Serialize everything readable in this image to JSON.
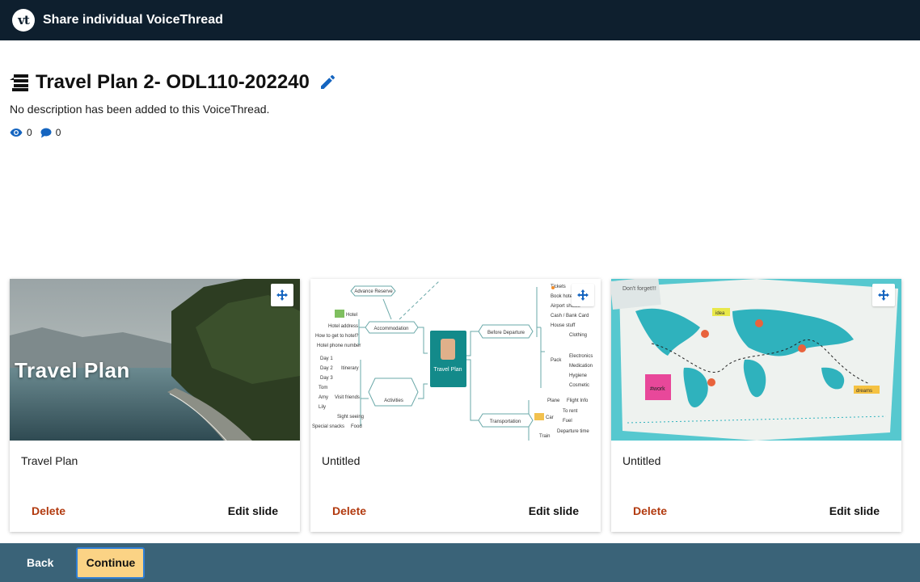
{
  "app": {
    "window_title": "Share individual VoiceThread",
    "logo_text": "vt"
  },
  "voicethread": {
    "title": "Travel Plan 2- ODL110-202240",
    "description": "No description has been added to this VoiceThread.",
    "views": "0",
    "comments": "0"
  },
  "slides": [
    {
      "title": "Travel Plan",
      "thumbnail_text": "Travel Plan",
      "delete_label": "Delete",
      "edit_label": "Edit slide"
    },
    {
      "title": "Untitled",
      "delete_label": "Delete",
      "edit_label": "Edit slide",
      "mindmap": {
        "center": "Travel Plan",
        "nodes": [
          "Advance Reserve",
          "Accommodation",
          "Activities",
          "Before Departure",
          "Transportation",
          "Hotel",
          "Hotel address",
          "How to get to hotel?",
          "Hotel phone number",
          "Day 1",
          "Day 2",
          "Day 3",
          "Itinerary",
          "Tom",
          "Amy",
          "Lily",
          "Visit friends",
          "Sight seeing",
          "Special snacks",
          "Food",
          "Tickets",
          "Book hotel",
          "Airport shuttle",
          "Cash / Bank Card",
          "House stuff",
          "Clothing",
          "Pack",
          "Electronics",
          "Medication",
          "Hygiene",
          "Cosmetic",
          "Plane",
          "Flight Info",
          "Car",
          "To rent",
          "Fuel",
          "Train",
          "Departure time"
        ]
      }
    },
    {
      "title": "Untitled",
      "delete_label": "Delete",
      "edit_label": "Edit slide",
      "map_notes": [
        "Don't forget!!!",
        "#work",
        "idea",
        "dreams"
      ]
    }
  ],
  "footer": {
    "back_label": "Back",
    "continue_label": "Continue"
  },
  "colors": {
    "topbar": "#0e1f2e",
    "footer": "#3a6378",
    "continue_bg": "#fbd385",
    "delete": "#b23a0f",
    "accent": "#1565c0"
  }
}
